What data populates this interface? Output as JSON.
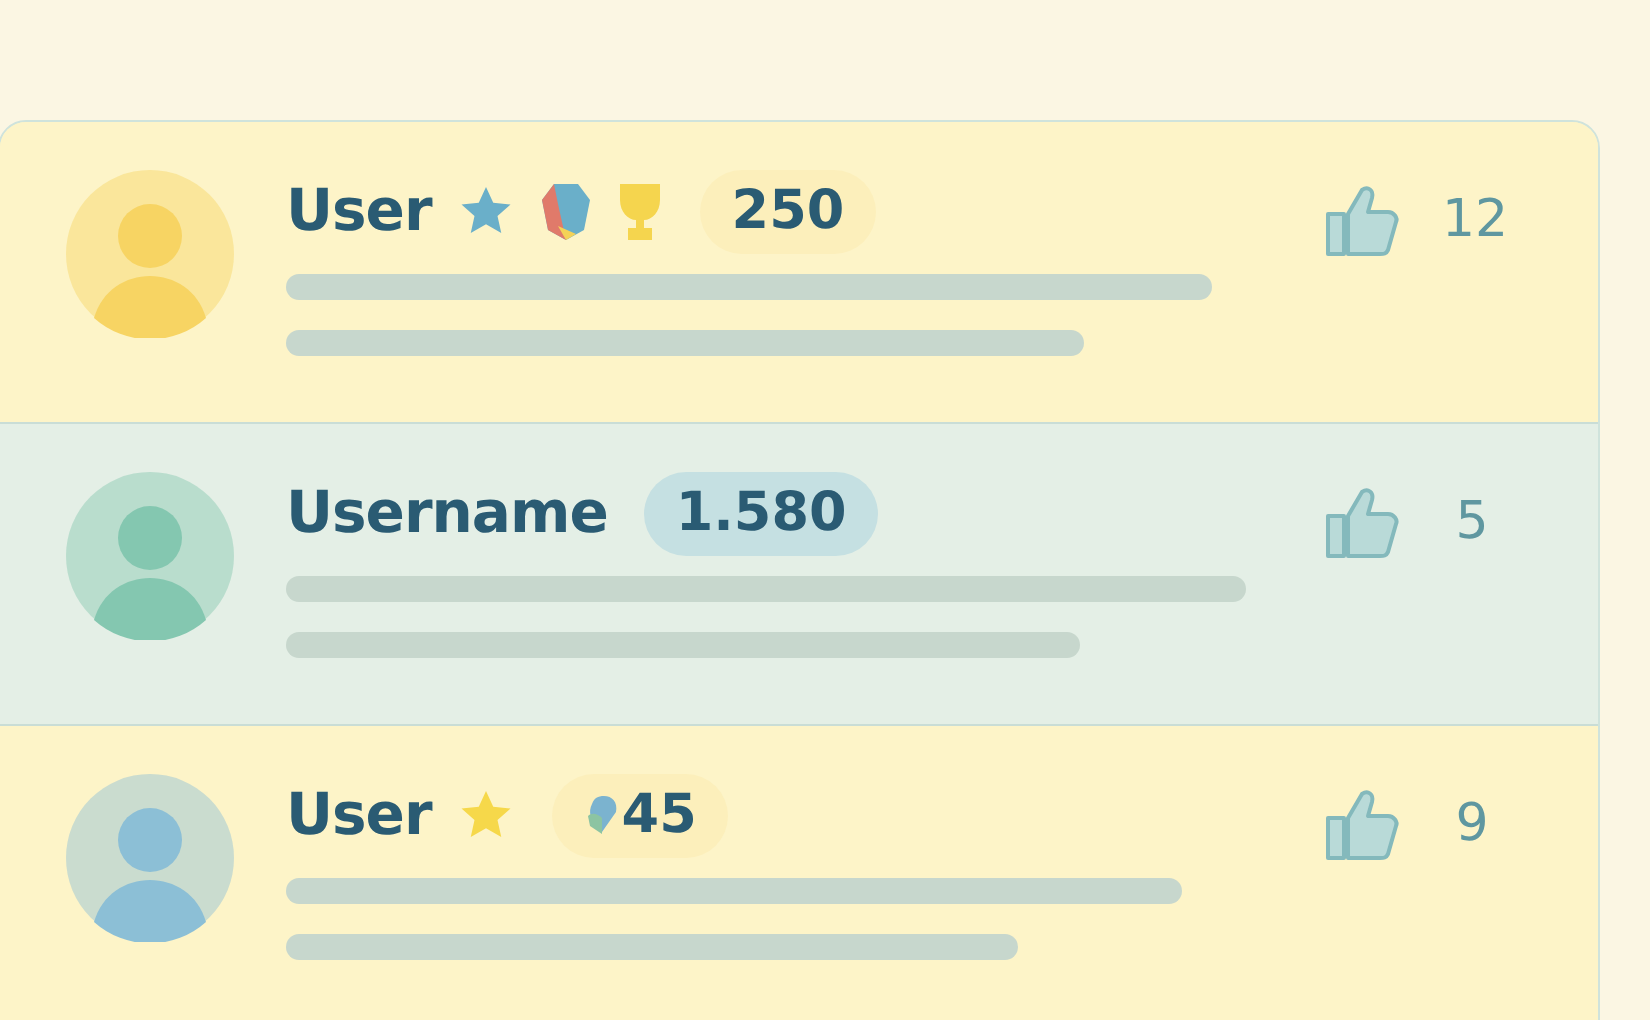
{
  "rows": [
    {
      "name": "User",
      "selected": false,
      "color": "#f7d463",
      "badges": [
        {
          "kind": "star",
          "color": "#6aafc9"
        },
        {
          "kind": "gem",
          "color": "#6aafc9"
        },
        {
          "kind": "trophy",
          "color": "#f5d54e"
        }
      ],
      "score": "250",
      "likes": "12"
    },
    {
      "name": "Username",
      "selected": true,
      "color": "#84c7b0",
      "badges": [],
      "score": "1.580",
      "likes": "5"
    },
    {
      "name": "User",
      "selected": false,
      "color": "#8cbfd6",
      "badges": [
        {
          "kind": "star",
          "color": "#f6d84a"
        }
      ],
      "score_icons": [
        {
          "kind": "heart"
        }
      ],
      "score": "45",
      "likes": "9"
    }
  ]
}
